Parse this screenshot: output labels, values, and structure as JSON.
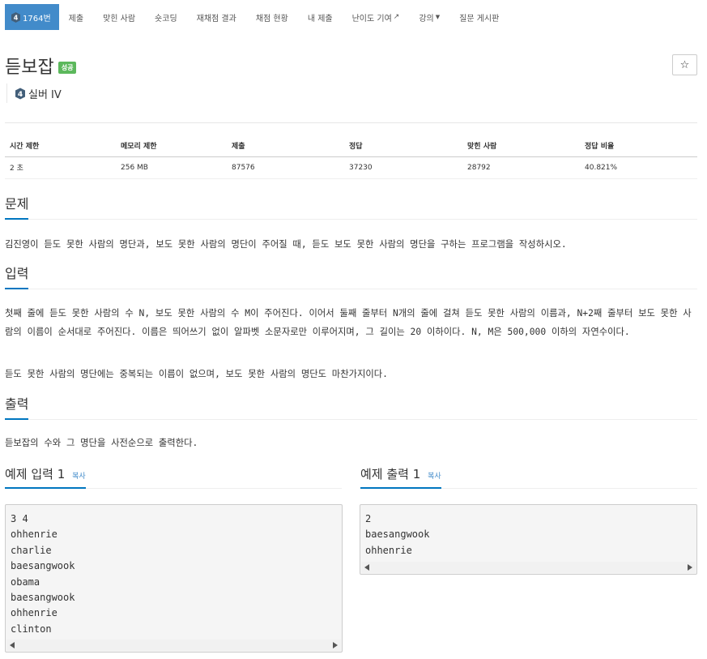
{
  "nav": {
    "problem_number": "1764번",
    "tier_number": "4",
    "items": [
      "제출",
      "맞힌 사람",
      "숏코딩",
      "재채점 결과",
      "채점 현황",
      "내 제출",
      "난이도 기여",
      "강의",
      "질문 게시판"
    ]
  },
  "problem": {
    "title": "듣보잡",
    "status_badge": "성공",
    "star": "☆",
    "tier_number": "4",
    "tier_label": "실버 IV"
  },
  "info_table": {
    "headers": [
      "시간 제한",
      "메모리 제한",
      "제출",
      "정답",
      "맞힌 사람",
      "정답 비율"
    ],
    "values": [
      "2 초",
      "256 MB",
      "87576",
      "37230",
      "28792",
      "40.821%"
    ]
  },
  "sections": {
    "description_title": "문제",
    "description": "김진영이 듣도 못한 사람의 명단과, 보도 못한 사람의 명단이 주어질 때, 듣도 보도 못한 사람의 명단을 구하는 프로그램을 작성하시오.",
    "input_title": "입력",
    "input_p1": "첫째 줄에 듣도 못한 사람의 수 N, 보도 못한 사람의 수 M이 주어진다. 이어서 둘째 줄부터 N개의 줄에 걸쳐 듣도 못한 사람의 이름과, N+2째 줄부터 보도 못한 사람의 이름이 순서대로 주어진다. 이름은 띄어쓰기 없이 알파벳 소문자로만 이루어지며, 그 길이는 20 이하이다. N, M은 500,000 이하의 자연수이다.",
    "input_p2": "듣도 못한 사람의 명단에는 중복되는 이름이 없으며, 보도 못한 사람의 명단도 마찬가지이다.",
    "output_title": "출력",
    "output": "듣보잡의 수와 그 명단을 사전순으로 출력한다."
  },
  "samples": {
    "input_title": "예제 입력 1",
    "output_title": "예제 출력 1",
    "copy_label": "복사",
    "input_text": "3 4\nohhenrie\ncharlie\nbaesangwook\nobama\nbaesangwook\nohhenrie\nclinton",
    "output_text": "2\nbaesangwook\nohhenrie"
  },
  "colors": {
    "nav_active": "#428bca",
    "badge_success": "#5cb85c",
    "section_underline": "#0076c0",
    "copy_link": "#428bca"
  }
}
